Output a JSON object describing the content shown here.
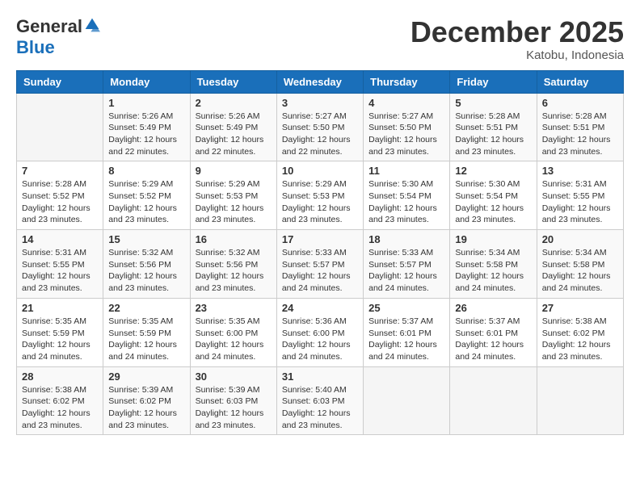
{
  "logo": {
    "general": "General",
    "blue": "Blue"
  },
  "title": "December 2025",
  "subtitle": "Katobu, Indonesia",
  "days_header": [
    "Sunday",
    "Monday",
    "Tuesday",
    "Wednesday",
    "Thursday",
    "Friday",
    "Saturday"
  ],
  "weeks": [
    [
      {
        "day": "",
        "info": ""
      },
      {
        "day": "1",
        "info": "Sunrise: 5:26 AM\nSunset: 5:49 PM\nDaylight: 12 hours\nand 22 minutes."
      },
      {
        "day": "2",
        "info": "Sunrise: 5:26 AM\nSunset: 5:49 PM\nDaylight: 12 hours\nand 22 minutes."
      },
      {
        "day": "3",
        "info": "Sunrise: 5:27 AM\nSunset: 5:50 PM\nDaylight: 12 hours\nand 22 minutes."
      },
      {
        "day": "4",
        "info": "Sunrise: 5:27 AM\nSunset: 5:50 PM\nDaylight: 12 hours\nand 23 minutes."
      },
      {
        "day": "5",
        "info": "Sunrise: 5:28 AM\nSunset: 5:51 PM\nDaylight: 12 hours\nand 23 minutes."
      },
      {
        "day": "6",
        "info": "Sunrise: 5:28 AM\nSunset: 5:51 PM\nDaylight: 12 hours\nand 23 minutes."
      }
    ],
    [
      {
        "day": "7",
        "info": "Sunrise: 5:28 AM\nSunset: 5:52 PM\nDaylight: 12 hours\nand 23 minutes."
      },
      {
        "day": "8",
        "info": "Sunrise: 5:29 AM\nSunset: 5:52 PM\nDaylight: 12 hours\nand 23 minutes."
      },
      {
        "day": "9",
        "info": "Sunrise: 5:29 AM\nSunset: 5:53 PM\nDaylight: 12 hours\nand 23 minutes."
      },
      {
        "day": "10",
        "info": "Sunrise: 5:29 AM\nSunset: 5:53 PM\nDaylight: 12 hours\nand 23 minutes."
      },
      {
        "day": "11",
        "info": "Sunrise: 5:30 AM\nSunset: 5:54 PM\nDaylight: 12 hours\nand 23 minutes."
      },
      {
        "day": "12",
        "info": "Sunrise: 5:30 AM\nSunset: 5:54 PM\nDaylight: 12 hours\nand 23 minutes."
      },
      {
        "day": "13",
        "info": "Sunrise: 5:31 AM\nSunset: 5:55 PM\nDaylight: 12 hours\nand 23 minutes."
      }
    ],
    [
      {
        "day": "14",
        "info": "Sunrise: 5:31 AM\nSunset: 5:55 PM\nDaylight: 12 hours\nand 23 minutes."
      },
      {
        "day": "15",
        "info": "Sunrise: 5:32 AM\nSunset: 5:56 PM\nDaylight: 12 hours\nand 23 minutes."
      },
      {
        "day": "16",
        "info": "Sunrise: 5:32 AM\nSunset: 5:56 PM\nDaylight: 12 hours\nand 23 minutes."
      },
      {
        "day": "17",
        "info": "Sunrise: 5:33 AM\nSunset: 5:57 PM\nDaylight: 12 hours\nand 24 minutes."
      },
      {
        "day": "18",
        "info": "Sunrise: 5:33 AM\nSunset: 5:57 PM\nDaylight: 12 hours\nand 24 minutes."
      },
      {
        "day": "19",
        "info": "Sunrise: 5:34 AM\nSunset: 5:58 PM\nDaylight: 12 hours\nand 24 minutes."
      },
      {
        "day": "20",
        "info": "Sunrise: 5:34 AM\nSunset: 5:58 PM\nDaylight: 12 hours\nand 24 minutes."
      }
    ],
    [
      {
        "day": "21",
        "info": "Sunrise: 5:35 AM\nSunset: 5:59 PM\nDaylight: 12 hours\nand 24 minutes."
      },
      {
        "day": "22",
        "info": "Sunrise: 5:35 AM\nSunset: 5:59 PM\nDaylight: 12 hours\nand 24 minutes."
      },
      {
        "day": "23",
        "info": "Sunrise: 5:35 AM\nSunset: 6:00 PM\nDaylight: 12 hours\nand 24 minutes."
      },
      {
        "day": "24",
        "info": "Sunrise: 5:36 AM\nSunset: 6:00 PM\nDaylight: 12 hours\nand 24 minutes."
      },
      {
        "day": "25",
        "info": "Sunrise: 5:37 AM\nSunset: 6:01 PM\nDaylight: 12 hours\nand 24 minutes."
      },
      {
        "day": "26",
        "info": "Sunrise: 5:37 AM\nSunset: 6:01 PM\nDaylight: 12 hours\nand 24 minutes."
      },
      {
        "day": "27",
        "info": "Sunrise: 5:38 AM\nSunset: 6:02 PM\nDaylight: 12 hours\nand 23 minutes."
      }
    ],
    [
      {
        "day": "28",
        "info": "Sunrise: 5:38 AM\nSunset: 6:02 PM\nDaylight: 12 hours\nand 23 minutes."
      },
      {
        "day": "29",
        "info": "Sunrise: 5:39 AM\nSunset: 6:02 PM\nDaylight: 12 hours\nand 23 minutes."
      },
      {
        "day": "30",
        "info": "Sunrise: 5:39 AM\nSunset: 6:03 PM\nDaylight: 12 hours\nand 23 minutes."
      },
      {
        "day": "31",
        "info": "Sunrise: 5:40 AM\nSunset: 6:03 PM\nDaylight: 12 hours\nand 23 minutes."
      },
      {
        "day": "",
        "info": ""
      },
      {
        "day": "",
        "info": ""
      },
      {
        "day": "",
        "info": ""
      }
    ]
  ]
}
